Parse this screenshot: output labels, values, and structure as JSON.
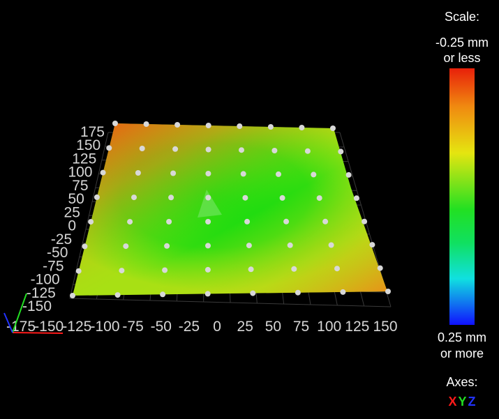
{
  "legend": {
    "title": "Scale:",
    "top_value": "-0.25 mm",
    "top_suffix": "or less",
    "bottom_value": "0.25 mm",
    "bottom_suffix": "or more",
    "axes_title": "Axes:",
    "axes": [
      {
        "label": "X",
        "color": "#ff1a1a"
      },
      {
        "label": "Y",
        "color": "#22dd22"
      },
      {
        "label": "Z",
        "color": "#2233ff"
      }
    ]
  },
  "plot": {
    "y_ticks": [
      "175",
      "150",
      "125",
      "100",
      "75",
      "50",
      "25",
      "0",
      "-25",
      "-50",
      "-75",
      "-100",
      "-125",
      "-150"
    ],
    "x_ticks": [
      "-175",
      "-150",
      "-125",
      "-100",
      "-75",
      "-50",
      "-25",
      "0",
      "25",
      "50",
      "75",
      "100",
      "125",
      "150"
    ],
    "surface_colors": {
      "green": "#10dd10",
      "yellow_green": "#a8e014",
      "orange": "#ee8818",
      "red": "#ee4410"
    }
  }
}
